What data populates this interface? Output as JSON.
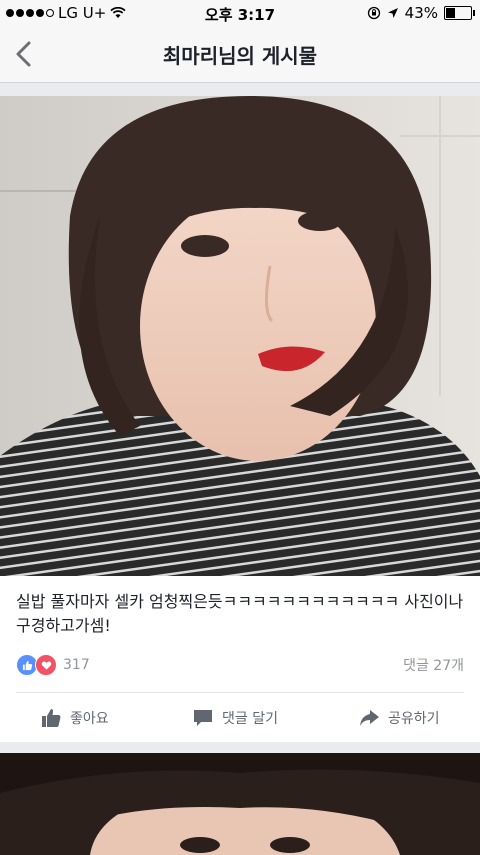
{
  "status_bar": {
    "carrier": "LG U+",
    "time": "오후 3:17",
    "battery": "43%",
    "battery_level": 0.43
  },
  "nav": {
    "title": "최마리님의 게시물"
  },
  "post": {
    "text": "실밥 풀자마자 셀카 엄청찍은듯ㅋㅋㅋㅋㅋㅋㅋㅋㅋㅋㅋㅋ 사진이나 구경하고가셈!",
    "reaction_count": "317",
    "comment_count": "댓글 27개",
    "actions": {
      "like": "좋아요",
      "comment": "댓글 달기",
      "share": "공유하기"
    }
  },
  "colors": {
    "like_blue": "#5890ff",
    "love_red": "#f25268",
    "meta_gray": "#90949c",
    "action_gray": "#606770"
  },
  "icons": [
    "back-chevron-icon",
    "wifi-icon",
    "lock-rotation-icon",
    "location-arrow-icon",
    "battery-icon",
    "like-reaction-icon",
    "love-reaction-icon",
    "thumbs-up-icon",
    "comment-icon",
    "share-icon"
  ]
}
